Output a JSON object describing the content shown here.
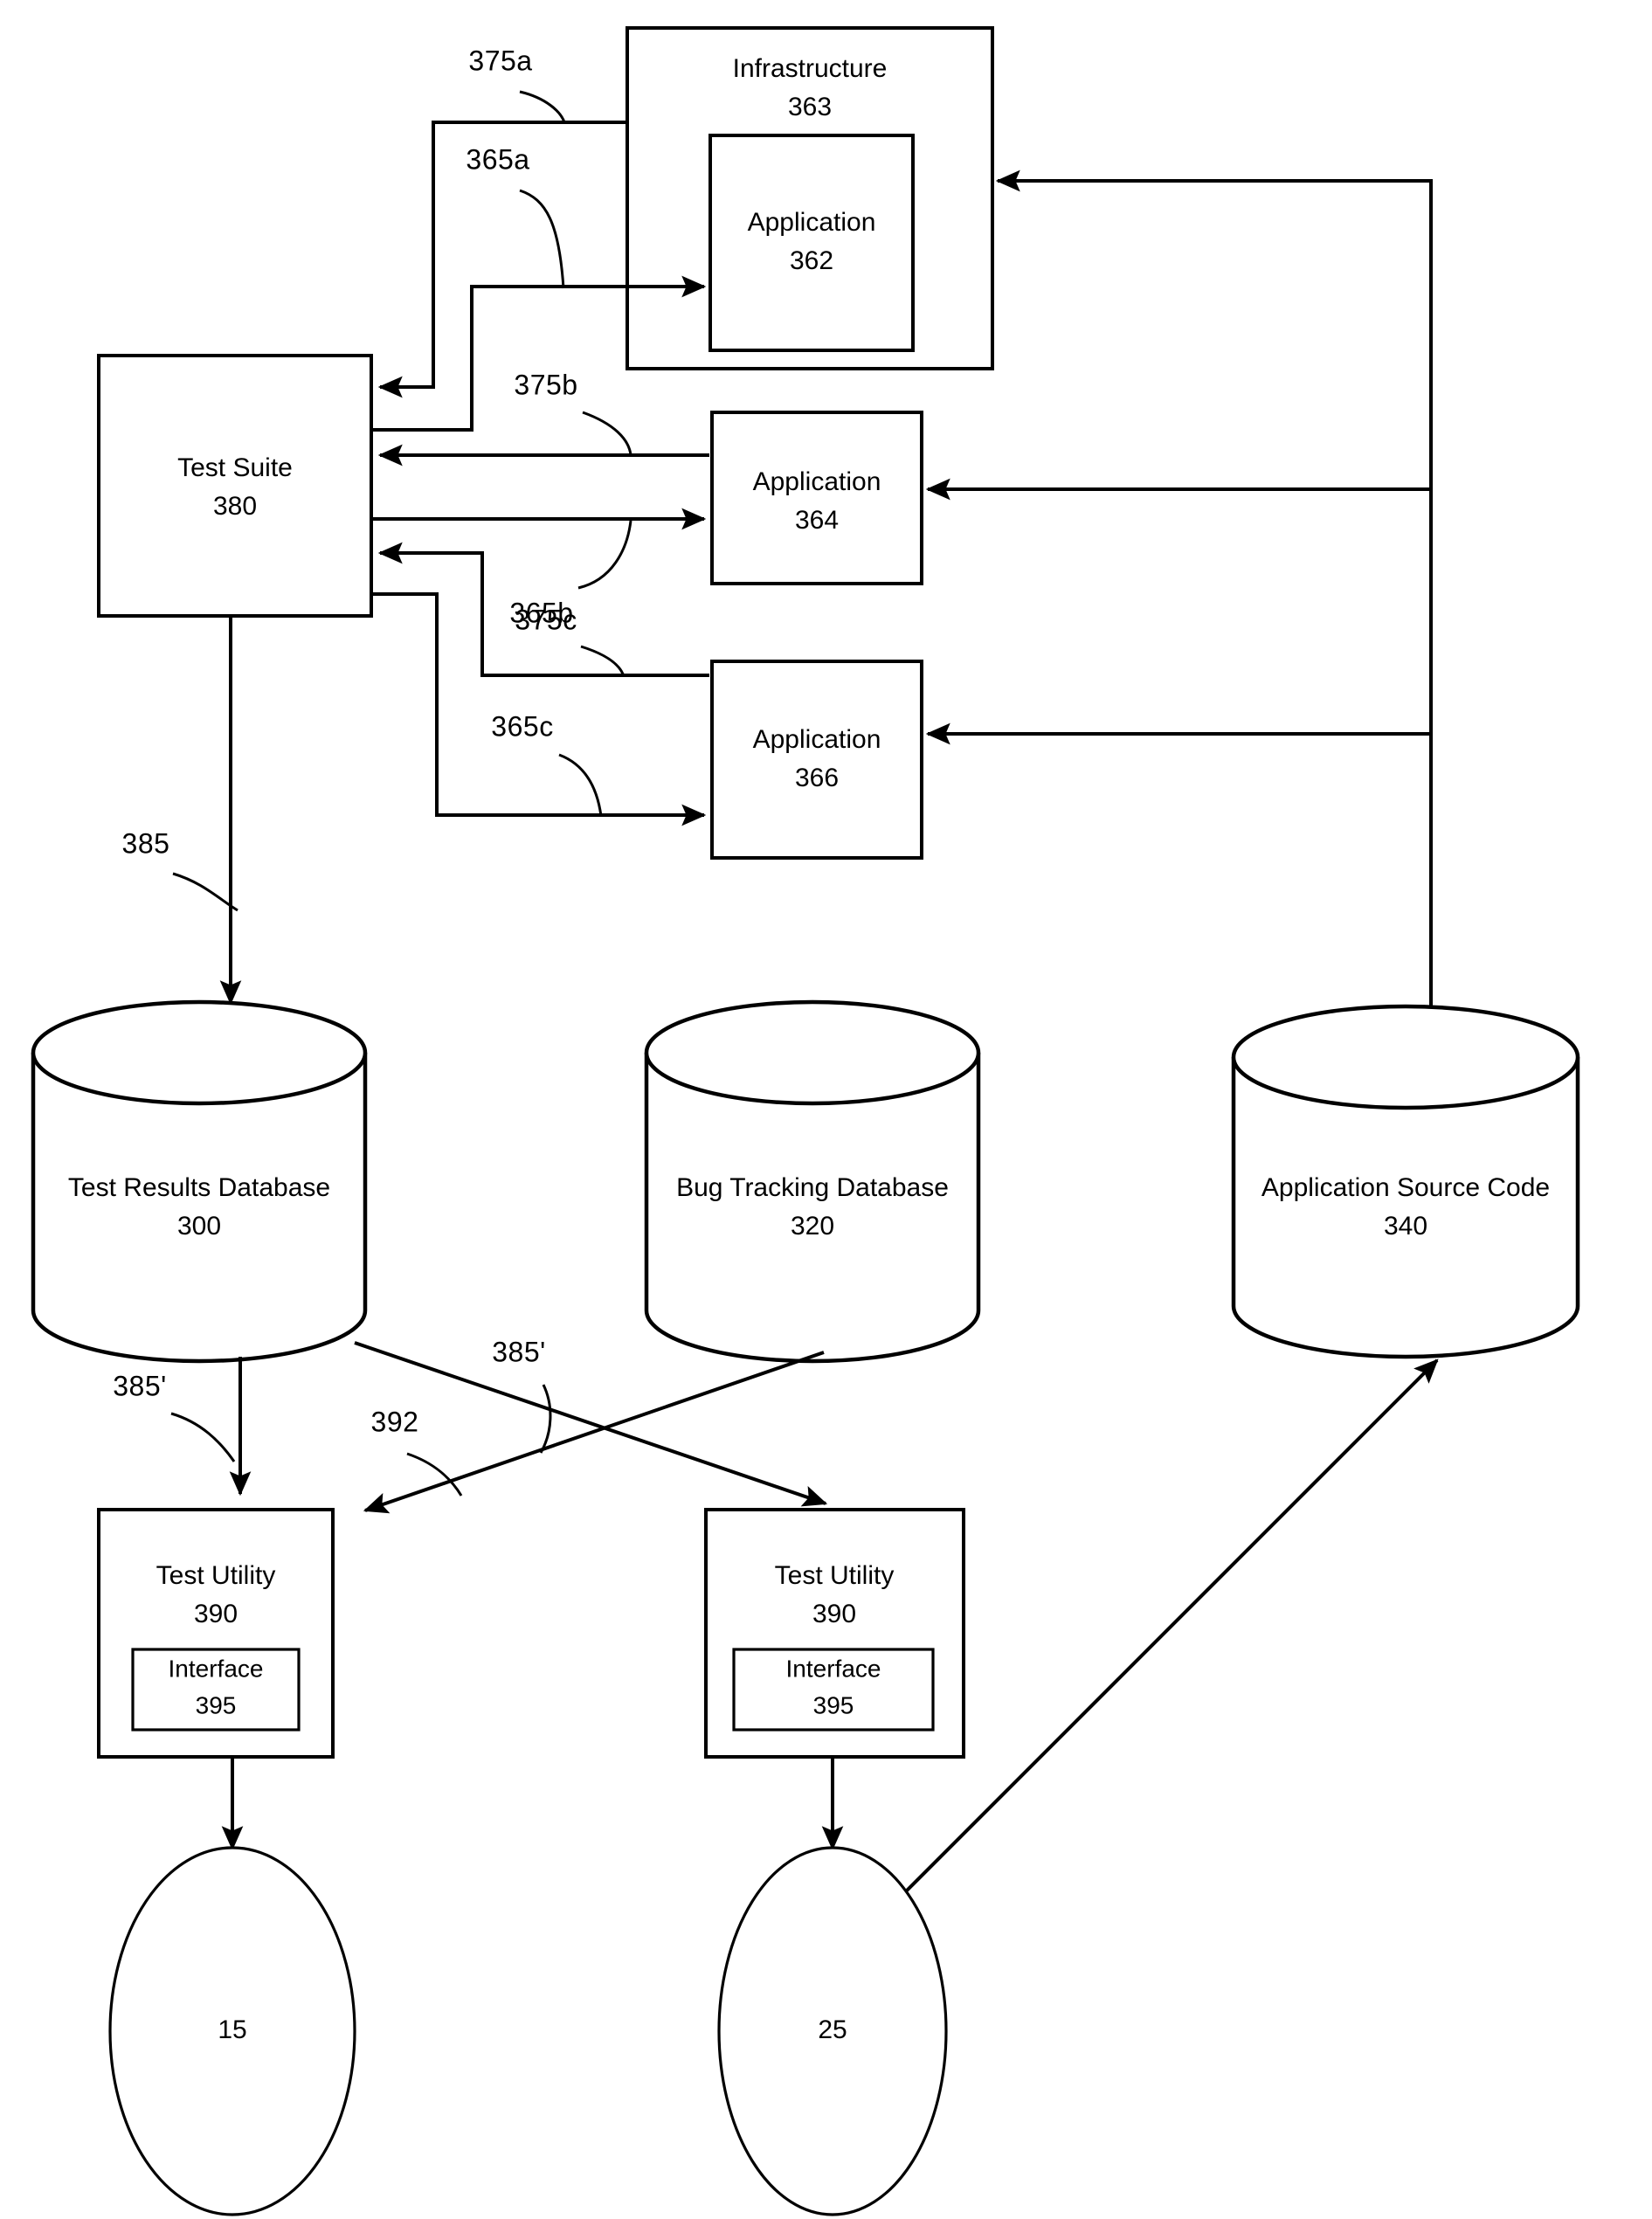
{
  "figure": {
    "type": "patent-block-diagram",
    "background": "#ffffff",
    "line_color": "#000000"
  },
  "nodes": {
    "infrastructure": {
      "title": "Infrastructure",
      "ref": "363"
    },
    "application_362": {
      "title": "Application",
      "ref": "362"
    },
    "application_364": {
      "title": "Application",
      "ref": "364"
    },
    "application_366": {
      "title": "Application",
      "ref": "366"
    },
    "test_suite": {
      "title": "Test Suite",
      "ref": "380"
    },
    "test_results_db": {
      "title": "Test Results Database",
      "ref": "300"
    },
    "bug_tracking_db": {
      "title": "Bug Tracking Database",
      "ref": "320"
    },
    "application_source_code": {
      "title": "Application Source Code",
      "ref": "340"
    },
    "test_utility_left": {
      "title": "Test Utility",
      "ref": "390"
    },
    "interface_left": {
      "title": "Interface",
      "ref": "395"
    },
    "test_utility_right": {
      "title": "Test Utility",
      "ref": "390"
    },
    "interface_right": {
      "title": "Interface",
      "ref": "395"
    },
    "terminal_15": {
      "label": "15"
    },
    "terminal_25": {
      "label": "25"
    }
  },
  "connector_labels": {
    "c375a": "375a",
    "c365a": "365a",
    "c375b": "375b",
    "c365b": "365b",
    "c375c": "375c",
    "c365c": "365c",
    "c385": "385",
    "c385_prime_left": "385'",
    "c385_prime_mid": "385'",
    "c392": "392"
  }
}
